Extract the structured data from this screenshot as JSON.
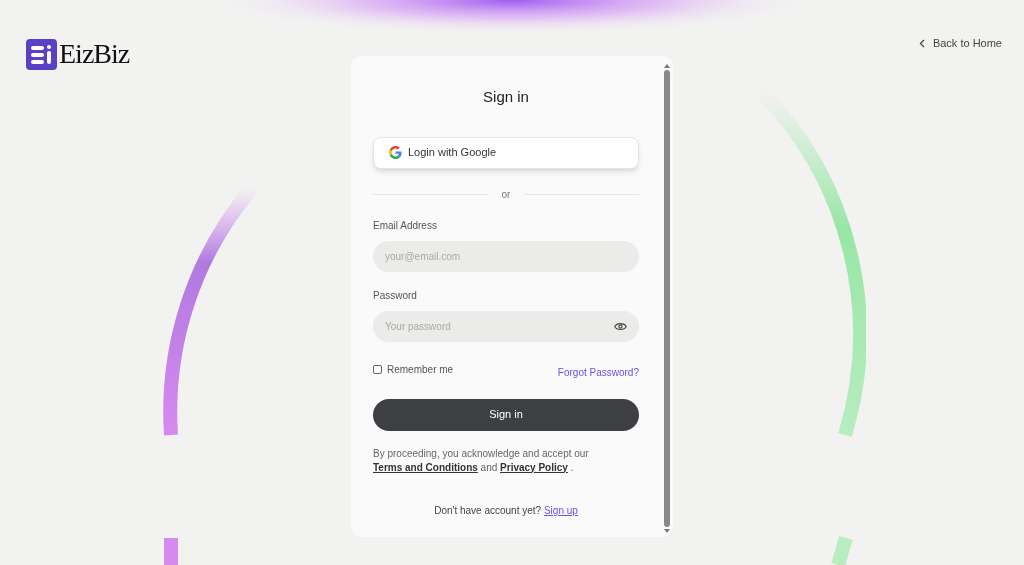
{
  "logo": {
    "text": "EizBiz"
  },
  "back_link": {
    "label": "Back to Home"
  },
  "form": {
    "title": "Sign in",
    "google_button": {
      "label": "Login with Google"
    },
    "divider": "or",
    "email": {
      "label": "Email Address",
      "placeholder": "your@email.com"
    },
    "password": {
      "label": "Password",
      "placeholder": "Your password"
    },
    "remember_me": {
      "label": "Remember me",
      "checked": false
    },
    "forgot_link": "Forgot Password?",
    "submit_button": "Sign in",
    "consent": {
      "before": "By proceeding, you acknowledge and accept our",
      "terms_link": "Terms and Conditions",
      "middle": "and",
      "privacy_link": "Privacy Policy",
      "after": "."
    },
    "signup": {
      "prompt": "Don't have account yet?",
      "link": "Sign up"
    }
  }
}
